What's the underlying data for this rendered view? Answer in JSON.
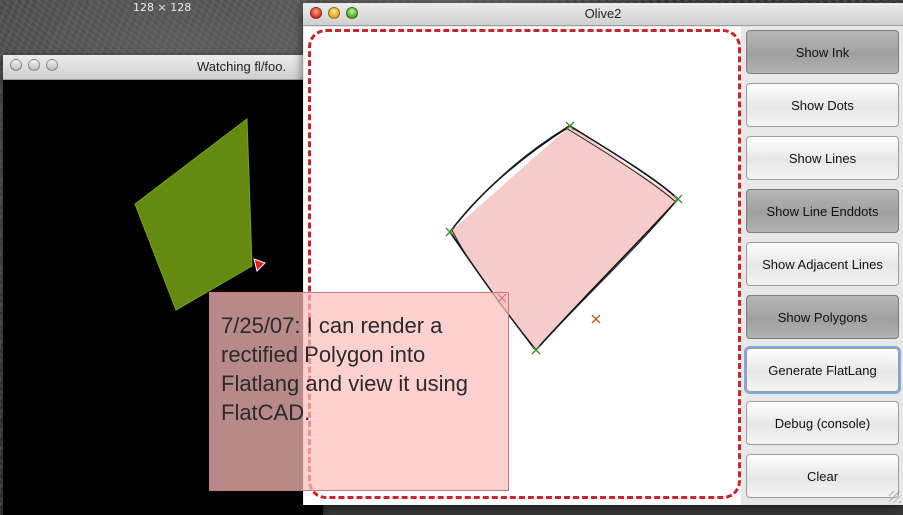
{
  "desktop": {
    "dimension_label": "128 × 128"
  },
  "watch_window": {
    "title": "Watching fl/foo."
  },
  "olive_window": {
    "title": "Olive2"
  },
  "buttons": [
    {
      "label": "Show Ink",
      "pressed": true
    },
    {
      "label": "Show Dots",
      "pressed": false
    },
    {
      "label": "Show Lines",
      "pressed": false
    },
    {
      "label": "Show Line Enddots",
      "pressed": true
    },
    {
      "label": "Show Adjacent Lines",
      "pressed": false
    },
    {
      "label": "Show Polygons",
      "pressed": true
    },
    {
      "label": "Generate FlatLang",
      "pressed": false,
      "focused": true
    },
    {
      "label": "Debug (console)",
      "pressed": false
    },
    {
      "label": "Clear",
      "pressed": false
    }
  ],
  "note": {
    "date": "7/25/07",
    "text": ": I can render a rectified Polygon into Flatlang and view it using FlatCAD."
  },
  "colors": {
    "annotation_red": "#c8262b",
    "polygon_fill": "#f6cbcb",
    "flat_polygon": "#648a10",
    "note_bg": "#ffbebe"
  }
}
